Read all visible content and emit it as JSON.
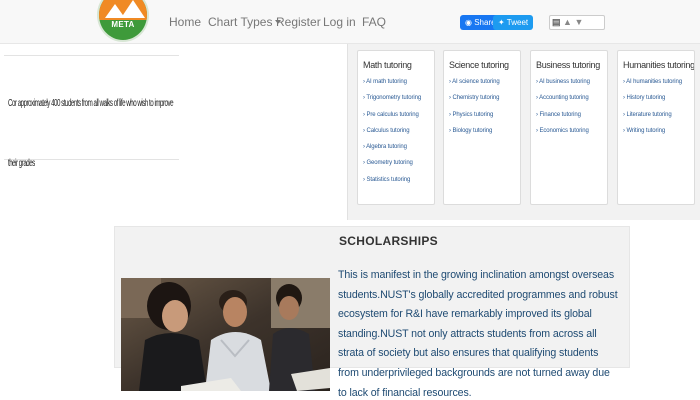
{
  "nav": {
    "logo_text": "META",
    "links": [
      "Home",
      "Chart Types",
      "Register",
      "Log in",
      "FAQ"
    ],
    "share_label": "Share",
    "tweet_label": "Tweet"
  },
  "banner": {
    "text": "Cor approximately 400 students from all walks of life who wish to improve their grades"
  },
  "tutoring": {
    "columns": [
      {
        "title": "Math tutoring",
        "items": [
          "AI math tutoring",
          "Trigonometry tutoring",
          "Pre calculus tutoring",
          "Calculus tutoring",
          "Algebra tutoring",
          "Geometry tutoring",
          "Statistics tutoring"
        ]
      },
      {
        "title": "Science tutoring",
        "items": [
          "AI science tutoring",
          "Chemistry tutoring",
          "Physics tutoring",
          "Biology tutoring"
        ]
      },
      {
        "title": "Business tutoring",
        "items": [
          "AI business tutoring",
          "Accounting tutoring",
          "Finance tutoring",
          "Economics tutoring"
        ]
      },
      {
        "title": "Humanities tutoring",
        "items": [
          "AI humanities tutoring",
          "History tutoring",
          "Literature tutoring",
          "Writing tutoring"
        ]
      }
    ]
  },
  "scholarships": {
    "title": "SCHOLARSHIPS",
    "body": "This is manifest in the growing inclination amongst overseas students.NUST's globally accredited programmes and robust ecosystem for R&I have remarkably improved its global standing.NUST not only attracts students from across all strata of society but also ensures that qualifying students from underprivileged backgrounds are not turned away due to lack of financial resources."
  },
  "colors": {
    "nav_bg": "#f8f8f8",
    "link_blue": "#2a5a94",
    "body_blue": "#1e4a72",
    "facebook": "#1877f2",
    "twitter": "#1d9bf0",
    "logo_green": "#3e9a3a",
    "logo_orange": "#f08a24"
  }
}
